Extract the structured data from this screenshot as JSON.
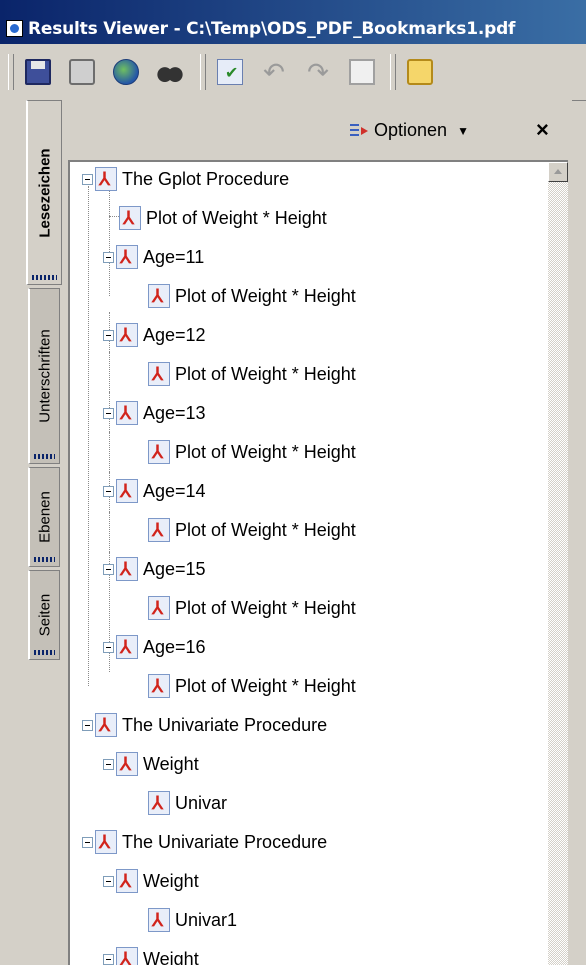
{
  "window": {
    "title": "Results Viewer - C:\\Temp\\ODS_PDF_Bookmarks1.pdf"
  },
  "toolbar": {
    "buttons": [
      "save-icon",
      "print-icon",
      "email-globe-icon",
      "find-binoculars-icon",
      "spellcheck-icon",
      "undo-icon",
      "redo-icon",
      "copy-icon",
      "comment-icon"
    ]
  },
  "side_tabs": [
    "Lesezeichen",
    "Unterschriften",
    "Ebenen",
    "Seiten"
  ],
  "panel": {
    "options_label": "Optionen",
    "close_label": "×"
  },
  "bookmarks": [
    "The Gplot Procedure",
    "Plot of Weight * Height",
    "Age=11",
    "Plot of Weight * Height",
    "Age=12",
    "Plot of Weight * Height",
    "Age=13",
    "Plot of Weight * Height",
    "Age=14",
    "Plot of Weight * Height",
    "Age=15",
    "Plot of Weight * Height",
    "Age=16",
    "Plot of Weight * Height",
    "The Univariate Procedure",
    "Weight",
    "Univar",
    "The Univariate Procedure",
    "Weight",
    "Univar1",
    "Weight"
  ]
}
